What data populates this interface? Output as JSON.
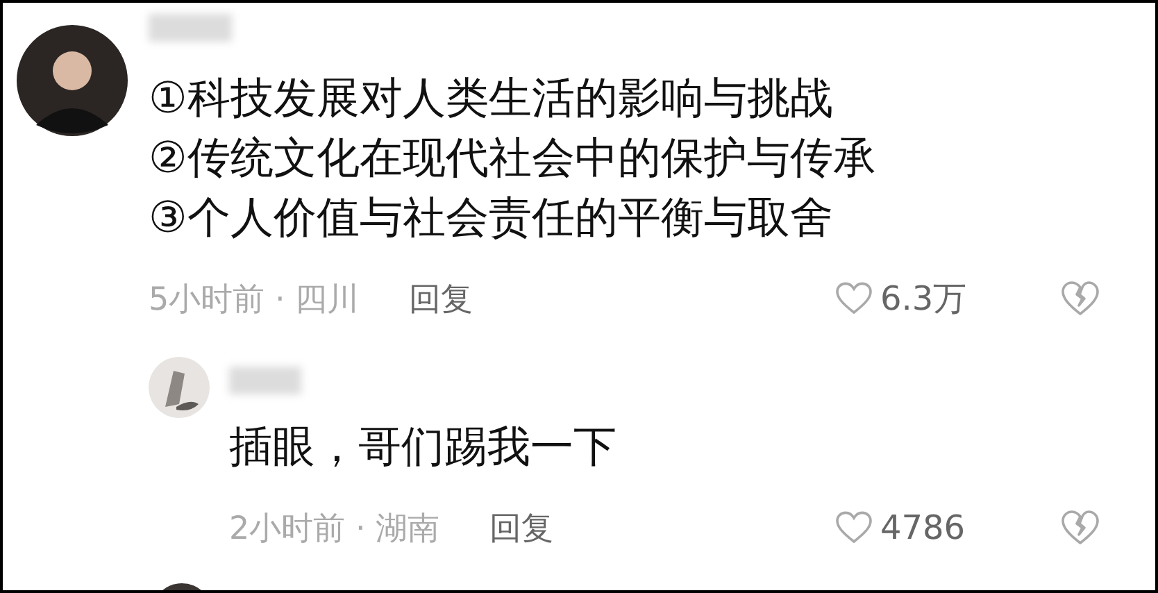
{
  "comments": [
    {
      "kind": "comment",
      "lines": [
        "①科技发展对人类生活的影响与挑战",
        "②传统文化在现代社会中的保护与传承",
        "③个人价值与社会责任的平衡与取舍"
      ],
      "meta": "5小时前 · 四川",
      "reply": "回复",
      "likes": "6.3万"
    },
    {
      "kind": "reply",
      "lines": [
        "插眼，哥们踢我一下"
      ],
      "meta": "2小时前 · 湖南",
      "reply": "回复",
      "likes": "4786"
    }
  ]
}
